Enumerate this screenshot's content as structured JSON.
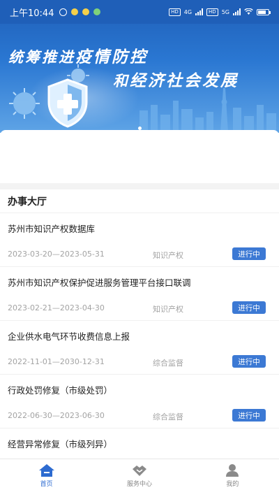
{
  "status_bar": {
    "time": "上午10:44",
    "network_1": "4G",
    "network_2": "5G",
    "hd": "HD"
  },
  "banner": {
    "line1_prefix": "统筹推进",
    "line1_big": "疫情防控",
    "line2_prefix": "和",
    "line2_big": "经济社会发展"
  },
  "section": {
    "title": "办事大厅"
  },
  "items": [
    {
      "title": "苏州市知识产权数据库",
      "date": "2023-03-20—2023-05-31",
      "category": "知识产权",
      "status": "进行中"
    },
    {
      "title": "苏州市知识产权保护促进服务管理平台接口联调",
      "date": "2023-02-21—2023-04-30",
      "category": "知识产权",
      "status": "进行中"
    },
    {
      "title": "企业供水电气环节收费信息上报",
      "date": "2022-11-01—2030-12-31",
      "category": "综合监督",
      "status": "进行中"
    },
    {
      "title": "行政处罚修复（市级处罚）",
      "date": "2022-06-30—2023-06-30",
      "category": "综合监督",
      "status": "进行中"
    },
    {
      "title": "经营异常修复（市级列异）",
      "date": "",
      "category": "",
      "status": ""
    }
  ],
  "nav": {
    "home": "首页",
    "service": "服务中心",
    "mine": "我的",
    "active": "home"
  },
  "colors": {
    "primary": "#2d6bd0",
    "status_badge": "#3c79d4",
    "banner_top": "#1f5fb8"
  }
}
